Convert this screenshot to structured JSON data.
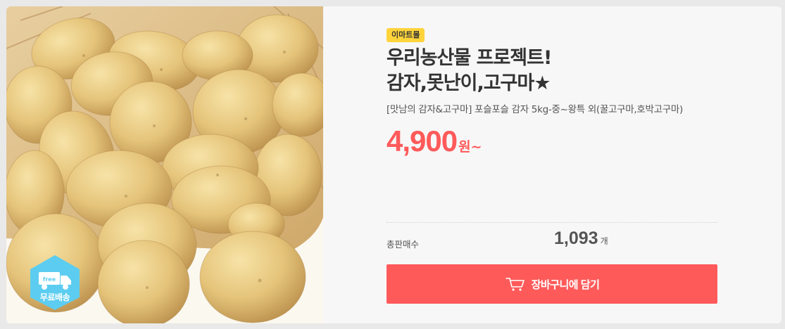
{
  "product": {
    "image_alt": "감자",
    "free_shipping_icon_text": "free",
    "free_shipping_label": "무료배송",
    "brand": "이마트몰",
    "title_lines": [
      "우리농산물 프로젝트!",
      "감자,못난이,고구마★"
    ],
    "subtitle": "[맛남의 감자&고구마] 포슬포슬 감자 5kg-중~왕특 외(꿀고구마,호박고구마)",
    "price": {
      "value": "4,900",
      "unit": "원~"
    },
    "sales": {
      "label": "총판매수",
      "value": "1,093",
      "unit": "개"
    },
    "cart_button_label": "장바구니에 담기"
  },
  "colors": {
    "accent": "#ff5a5a",
    "brand_badge": "#ffd43b",
    "free_badge": "#5ccdf0",
    "card_background": "#f7f7f7"
  },
  "icons": {
    "cart": "cart-icon",
    "truck": "truck-icon"
  }
}
